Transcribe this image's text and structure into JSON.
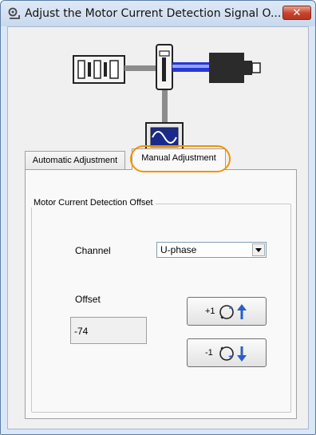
{
  "window": {
    "title": "Adjust the Motor Current Detection Signal O...",
    "close_glyph": "✕"
  },
  "tabs": [
    {
      "label": "Automatic Adjustment",
      "selected": false
    },
    {
      "label": "Manual Adjustment",
      "selected": true
    }
  ],
  "group": {
    "title": "Motor Current Detection Offset"
  },
  "channel": {
    "label": "Channel",
    "selected": "U-phase"
  },
  "offset": {
    "label": "Offset",
    "value": "-74"
  },
  "buttons": {
    "increment_label": "+1",
    "decrement_label": "-1"
  },
  "icons": {
    "title": "servo-settings-icon",
    "diagram": "servo-system-diagram",
    "increment": "rotate-up-icon",
    "decrement": "rotate-down-icon"
  },
  "colors": {
    "highlight": "#f39200",
    "cable_blue": "#2a36d6",
    "arrow_blue": "#2a5fc8"
  }
}
